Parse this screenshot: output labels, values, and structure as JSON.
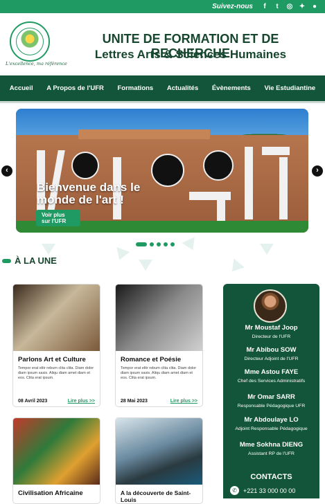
{
  "topbar": {
    "follow_label": "Suivez-nous",
    "social": [
      {
        "icon": "facebook-icon",
        "glyph": "f"
      },
      {
        "icon": "twitter-icon",
        "glyph": "t"
      },
      {
        "icon": "instagram-icon",
        "glyph": "◎"
      },
      {
        "icon": "twitter-bird-icon",
        "glyph": "✦"
      },
      {
        "icon": "github-icon",
        "glyph": "●"
      }
    ]
  },
  "header": {
    "logo_slogan": "L'excellence, ma référence",
    "title_line1": "UNITE DE FORMATION ET DE RECHERCHE",
    "title_line2": "Lettres Arts & Sciences Humaines"
  },
  "nav": {
    "items": [
      "Accueil",
      "A Propos de l'UFR",
      "Formations",
      "Actualités",
      "Évènements",
      "Vie Estudiantine"
    ]
  },
  "hero": {
    "heading_line1": "Bienvenue dans le",
    "heading_line2": "monde de l'art !",
    "button_line1": "Voir plus",
    "button_line2": "sur l'UFR",
    "prev": "‹",
    "next": "›"
  },
  "section": {
    "title": "À LA UNE"
  },
  "cards": [
    {
      "title": "Parlons Art et Culture",
      "text": "Tempor erat elitr rebum clita clita. Diam dolor diam ipsum sasis. Aliqu diam amet diam et eos. Clita erat ipsum.",
      "date": "08 Avril 2023",
      "more": "Lire plus >>"
    },
    {
      "title": "Romance et Poésie",
      "text": "Tempor erat elitr rebum clita clita. Diam dolor diam ipsum sasis. Aliqu diam amet diam et eos. Clita erat ipsum.",
      "date": "28 Mai 2023",
      "more": "Lire plus >>"
    },
    {
      "title": "Civilisation Africaine",
      "text": "",
      "date": "",
      "more": ""
    },
    {
      "title": "A la découverte de Saint-Louis",
      "text": "",
      "date": "",
      "more": ""
    }
  ],
  "staff": [
    {
      "name": "Mr Moustaf Joop",
      "role": "Directeur de l'UFR"
    },
    {
      "name": "Mr Abibou SOW",
      "role": "Directeur Adjoint de l'UFR"
    },
    {
      "name": "Mme Astou FAYE",
      "role": "Chef des Services Administratifs"
    },
    {
      "name": "Mr Omar SARR",
      "role": "Responsable Pédagogique UFR"
    },
    {
      "name": "Mr Abdoulaye LO",
      "role": "Adjoint Responsable Pédagogique"
    },
    {
      "name": "Mme Sokhna DIENG",
      "role": "Assistant RP de l'UFR"
    }
  ],
  "contacts": {
    "title": "CONTACTS",
    "phone": "+221 33 000 00 00"
  },
  "colors": {
    "primary": "#1f9a63",
    "dark": "#13553a",
    "title": "#17462f"
  }
}
